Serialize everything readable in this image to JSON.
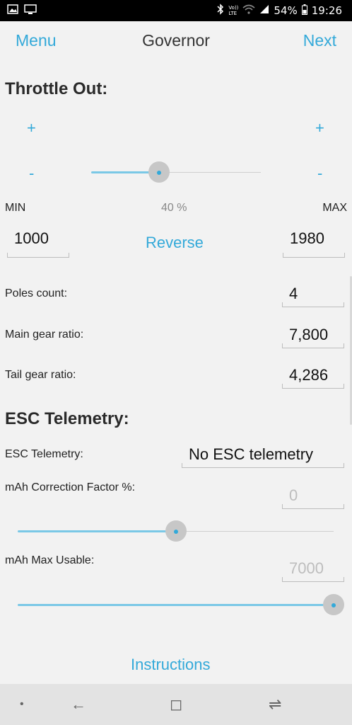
{
  "status_bar": {
    "icons_left": [
      "image-icon",
      "cast-icon"
    ],
    "icons_right": [
      "bluetooth-icon",
      "volte-icon",
      "wifi-icon",
      "signal-icon"
    ],
    "volte_text": "Vo)) LTE",
    "battery": "54%",
    "time": "19:26"
  },
  "header": {
    "menu": "Menu",
    "title": "Governor",
    "next": "Next"
  },
  "throttle": {
    "heading": "Throttle Out:",
    "plus": "+",
    "minus": "-",
    "slider_value": 0.4,
    "percent": "40 %",
    "min_label": "MIN",
    "max_label": "MAX",
    "min_value": "1000",
    "max_value": "1980",
    "reverse": "Reverse"
  },
  "settings": {
    "poles_label": "Poles count:",
    "poles_value": "4",
    "main_gear_label": "Main gear ratio:",
    "main_gear_value": "7,800",
    "tail_gear_label": "Tail gear ratio:",
    "tail_gear_value": "4,286"
  },
  "esc": {
    "heading": "ESC Telemetry:",
    "telemetry_label": "ESC Telemetry:",
    "telemetry_value": "No ESC telemetry",
    "correction_label": "mAh Correction Factor %:",
    "correction_value": "0",
    "correction_slider": 0.5,
    "max_usable_label": "mAh Max Usable:",
    "max_usable_value": "7000",
    "max_usable_slider": 1.0
  },
  "footer": {
    "instructions": "Instructions"
  },
  "nav": {
    "dot": "•",
    "back": "←",
    "home": "◻",
    "recents": "⇌"
  },
  "colors": {
    "accent": "#33a9d9",
    "track_fill": "#7ac8e6",
    "background": "#f2f2f2"
  }
}
